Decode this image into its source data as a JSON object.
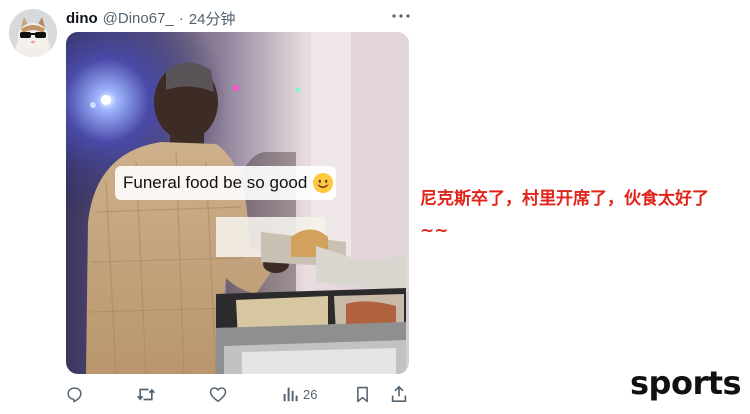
{
  "post": {
    "author_name": "dino",
    "handle": "@Dino67_",
    "separator": "·",
    "time": "24分钟",
    "media_caption": "Funeral food be so good",
    "emoji_icon": "smiling-face-emoji",
    "actions": {
      "reply_icon": "speech-bubble-icon",
      "retweet_icon": "retweet-arrows-icon",
      "like_icon": "heart-icon",
      "views_icon": "bar-chart-icon",
      "views_count": "26",
      "bookmark_icon": "bookmark-icon",
      "share_icon": "share-upload-icon"
    }
  },
  "annotation": {
    "text": "尼克斯卒了，村里开席了，伙食太好了~~",
    "color": "#e0241b"
  },
  "watermark": "sports"
}
